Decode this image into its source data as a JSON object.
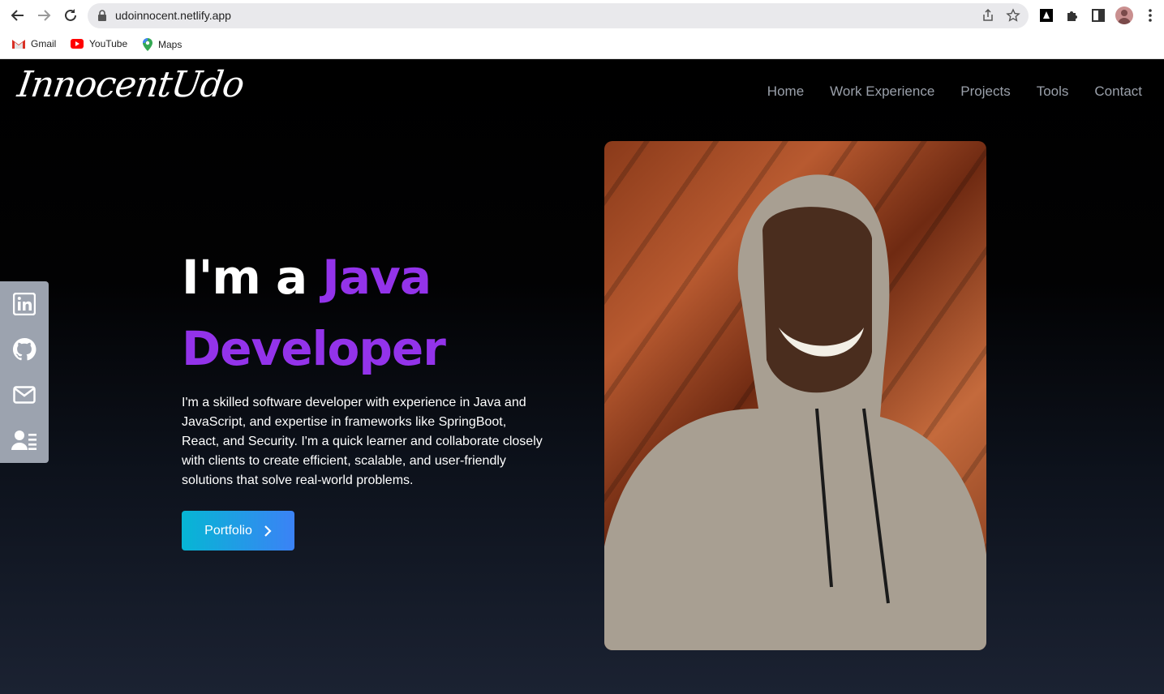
{
  "browser": {
    "url": "udoinnocent.netlify.app",
    "bookmarks": [
      {
        "label": "Gmail",
        "icon": "gmail-icon"
      },
      {
        "label": "YouTube",
        "icon": "youtube-icon"
      },
      {
        "label": "Maps",
        "icon": "maps-icon"
      }
    ]
  },
  "site": {
    "logo": "InnocentUdo",
    "nav": [
      "Home",
      "Work Experience",
      "Projects",
      "Tools",
      "Contact"
    ],
    "headline": {
      "prefix": "I'm a ",
      "accent_line1": "Java",
      "accent_line2": "Developer"
    },
    "intro": "I'm a skilled software developer with experience in Java and JavaScript, and expertise in frameworks like SpringBoot, React, and Security. I'm a quick learner and collaborate closely with clients to create efficient, scalable, and user-friendly solutions that solve real-world problems.",
    "cta_label": "Portfolio",
    "social": [
      "linkedin-icon",
      "github-icon",
      "mail-icon",
      "resume-icon"
    ]
  },
  "colors": {
    "accent": "#9333ea",
    "button_start": "#06b6d4",
    "button_end": "#3b82f6",
    "nav_text": "#9aa0aa"
  }
}
